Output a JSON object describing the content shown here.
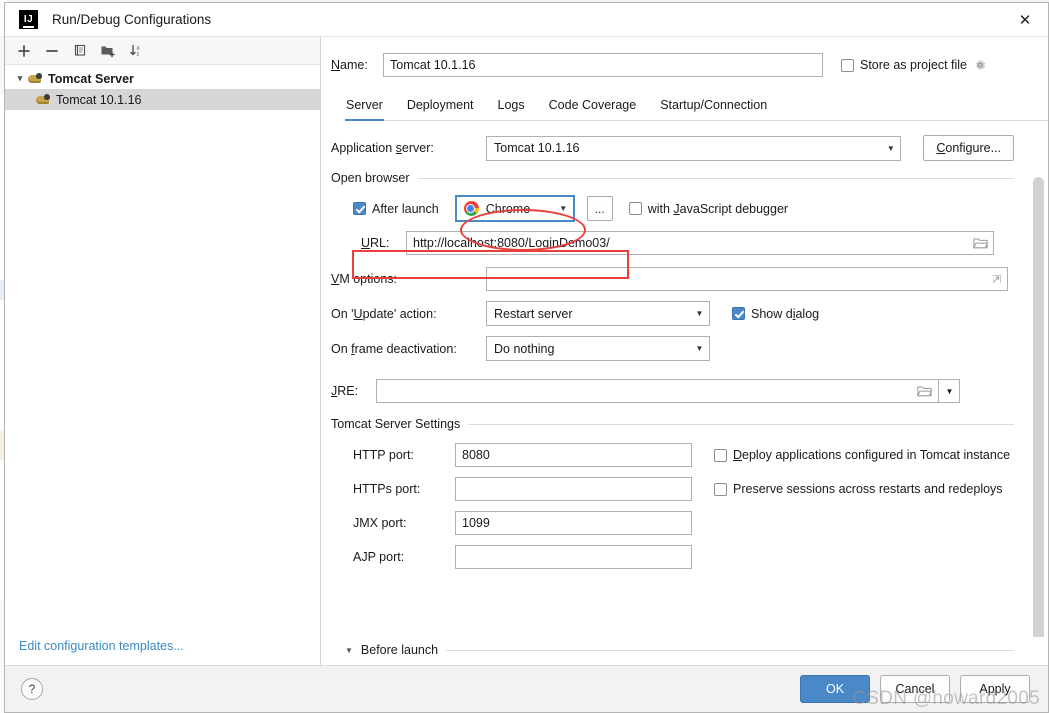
{
  "window": {
    "title": "Run/Debug Configurations",
    "logo_text": "IJ",
    "close_label": "✕"
  },
  "left_pane": {
    "toolbar": [
      {
        "name": "add-configuration-button",
        "icon": "plus-icon",
        "label": "+"
      },
      {
        "name": "remove-configuration-button",
        "icon": "minus-icon",
        "label": "−"
      },
      {
        "name": "copy-configuration-button",
        "icon": "copy-icon",
        "label": ""
      },
      {
        "name": "move-into-folder-button",
        "icon": "folder-add-icon",
        "label": ""
      },
      {
        "name": "sort-configurations-button",
        "icon": "sort-icon",
        "label": ""
      }
    ],
    "tree": [
      {
        "label": "Tomcat Server",
        "type": "group",
        "expanded": true,
        "selected": false
      },
      {
        "label": "Tomcat 10.1.16",
        "type": "item",
        "expanded": false,
        "selected": true
      }
    ],
    "edit_templates_link": "Edit configuration templates..."
  },
  "name_row": {
    "label": "Name:",
    "value": "Tomcat 10.1.16",
    "store_as_project_file": {
      "label": "Store as project file",
      "checked": false
    },
    "gear_icon": "gear-icon"
  },
  "tabs": [
    {
      "label": "Server",
      "active": true
    },
    {
      "label": "Deployment",
      "active": false
    },
    {
      "label": "Logs",
      "active": false
    },
    {
      "label": "Code Coverage",
      "active": false
    },
    {
      "label": "Startup/Connection",
      "active": false
    }
  ],
  "form": {
    "application_server": {
      "label": "Application server:",
      "value": "Tomcat 10.1.16",
      "configure_button": "Configure..."
    },
    "open_browser": {
      "title": "Open browser",
      "after_launch": {
        "label": "After launch",
        "checked": true
      },
      "browser": {
        "value": "Chrome",
        "icon": "chrome-icon"
      },
      "browse_button": "...",
      "js_debugger": {
        "label": "with JavaScript debugger",
        "checked": false
      },
      "url": {
        "label": "URL:",
        "value": "http://localhost:8080/LoginDemo03/",
        "folder_icon": "folder-icon"
      }
    },
    "vm_options": {
      "label": "VM options:",
      "value": "",
      "expand_icon": "expand-icon"
    },
    "on_update_action": {
      "label": "On 'Update' action:",
      "value": "Restart server",
      "show_dialog": {
        "label": "Show dialog",
        "checked": true
      }
    },
    "on_frame_deactivation": {
      "label": "On frame deactivation:",
      "value": "Do nothing"
    },
    "jre": {
      "label": "JRE:",
      "value": "",
      "folder_icon": "folder-icon"
    },
    "tomcat_server_settings": {
      "title": "Tomcat Server Settings",
      "http_port": {
        "label": "HTTP port:",
        "value": "8080"
      },
      "https_port": {
        "label": "HTTPs port:",
        "value": ""
      },
      "jmx_port": {
        "label": "JMX port:",
        "value": "1099"
      },
      "ajp_port": {
        "label": "AJP port:",
        "value": ""
      },
      "deploy_apps": {
        "label": "Deploy applications configured in Tomcat instance",
        "checked": false
      },
      "preserve_sessions": {
        "label": "Preserve sessions across restarts and redeploys",
        "checked": false
      }
    }
  },
  "before_launch": {
    "label": "Before launch",
    "expanded": false
  },
  "bottom_bar": {
    "help_label": "?",
    "ok_label": "OK",
    "cancel_label": "Cancel",
    "apply_label": "Apply"
  },
  "watermark": "CSDN @howard2005",
  "colors": {
    "accent": "#4a88c7",
    "annotation": "#e8413c",
    "link": "#3a8ac4",
    "selection": "#d6d6d6"
  }
}
